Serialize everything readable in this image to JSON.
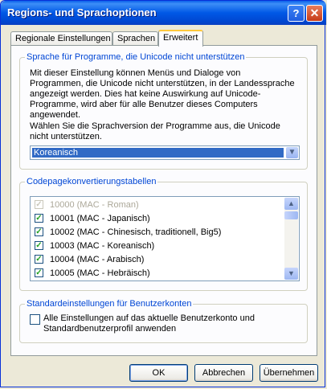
{
  "window": {
    "title": "Regions- und Sprachoptionen",
    "help_label": "?",
    "close_label": "✕"
  },
  "tabs": [
    {
      "label": "Regionale Einstellungen"
    },
    {
      "label": "Sprachen"
    },
    {
      "label": "Erweitert",
      "active": true
    }
  ],
  "unicode_group": {
    "legend": "Sprache für Programme, die Unicode nicht unterstützen",
    "description": "Mit dieser Einstellung können Menüs und Dialoge von Programmen, die Unicode nicht unterstützen, in der Landessprache angezeigt werden. Dies hat keine Auswirkung auf Unicode-Programme, wird aber für alle Benutzer dieses Computers angewendet.",
    "prompt": "Wählen Sie die Sprachversion der Programme aus, die Unicode nicht unterstützen.",
    "selected_language": "Koreanisch"
  },
  "codepage_group": {
    "legend": "Codepagekonvertierungstabellen",
    "items": [
      {
        "label": "10000 (MAC - Roman)",
        "checked": true,
        "disabled": true
      },
      {
        "label": "10001 (MAC - Japanisch)",
        "checked": true,
        "disabled": false
      },
      {
        "label": "10002 (MAC - Chinesisch, traditionell, Big5)",
        "checked": true,
        "disabled": false
      },
      {
        "label": "10003 (MAC - Koreanisch)",
        "checked": true,
        "disabled": false
      },
      {
        "label": "10004 (MAC - Arabisch)",
        "checked": true,
        "disabled": false
      },
      {
        "label": "10005 (MAC - Hebräisch)",
        "checked": true,
        "disabled": false
      }
    ]
  },
  "defaults_group": {
    "legend": "Standardeinstellungen für Benutzerkonten",
    "checkbox_label": "Alle Einstellungen auf das aktuelle Benutzerkonto und Standardbenutzerprofil anwenden",
    "checked": false
  },
  "buttons": {
    "ok": "OK",
    "cancel": "Abbrechen",
    "apply": "Übernehmen"
  },
  "colors": {
    "titlebar": "#0058e6",
    "legend": "#0046d5",
    "selection": "#316ac5",
    "check": "#21a121"
  }
}
